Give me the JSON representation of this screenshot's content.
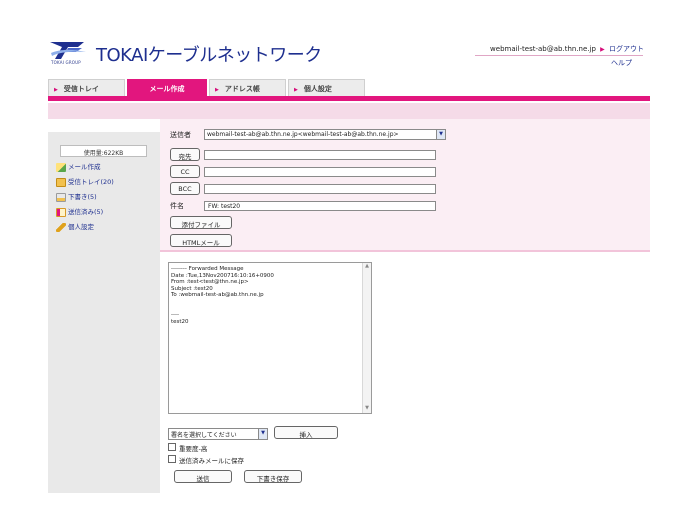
{
  "header": {
    "logo_sub": "TOKAI GROUP",
    "logo_text": "TOKAIケーブルネットワーク",
    "user_email": "webmail-test-ab@ab.thn.ne.jp",
    "logout_label": "ログアウト",
    "help_label": "ヘルプ"
  },
  "tabs": [
    {
      "label": "受信トレイ",
      "active": false
    },
    {
      "label": "メール作成",
      "active": true
    },
    {
      "label": "アドレス帳",
      "active": false
    },
    {
      "label": "個人設定",
      "active": false
    }
  ],
  "sidebar": {
    "usage": "使用量:622KB",
    "items": [
      {
        "label": "メール作成",
        "icon": "compose-icon"
      },
      {
        "label": "受信トレイ(20)",
        "icon": "inbox-icon"
      },
      {
        "label": "下書き(5)",
        "icon": "drafts-icon"
      },
      {
        "label": "送信済み(5)",
        "icon": "sent-icon"
      },
      {
        "label": "個人設定",
        "icon": "settings-icon"
      }
    ]
  },
  "form": {
    "from_label": "送信者",
    "from_value": "webmail-test-ab@ab.thn.ne.jp<webmail-test-ab@ab.thn.ne.jp>",
    "to_label": "宛先",
    "to_value": "",
    "cc_label": "CC",
    "cc_value": "",
    "bcc_label": "BCC",
    "bcc_value": "",
    "subject_label": "件名",
    "subject_value": "FW: test20",
    "attach_label": "添付ファイル",
    "html_label": "HTMLメール"
  },
  "body": {
    "lines": [
      "-------- Forwarded Message",
      "Date :Tue,13Nov200716:10:16+0900",
      "From :test<test@thn.ne.jp>",
      "Subject :test20",
      "To :webmail-test-ab@ab.thn.ne.jp",
      "",
      "",
      "----",
      "test20"
    ]
  },
  "bottom": {
    "signature_select": "署名を選択してください",
    "insert_label": "挿入",
    "priority_label": "重要度-高",
    "save_sent_label": "送信済みメールに保存",
    "send_label": "送信",
    "save_draft_label": "下書き保存"
  }
}
